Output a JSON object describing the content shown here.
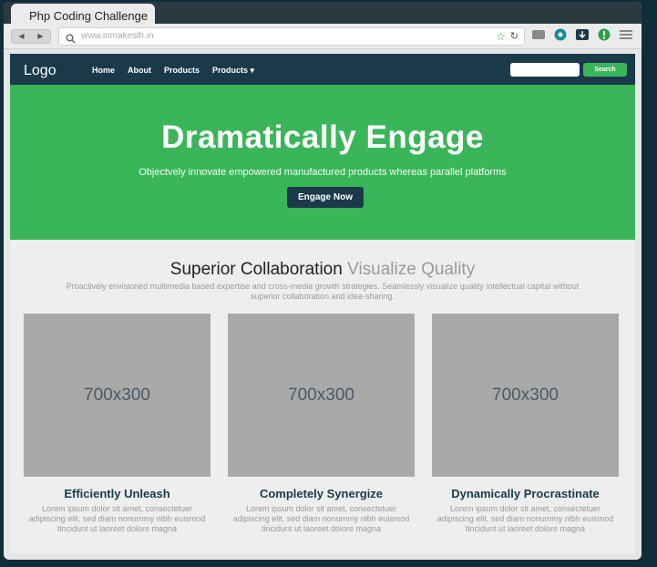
{
  "browser": {
    "tab_title": "Php Coding Challenge",
    "url": "www.inmakeslh.in",
    "nav": {
      "back": "◀",
      "forward": "▶"
    }
  },
  "navbar": {
    "logo": "Logo",
    "links": [
      "Home",
      "About",
      "Products",
      "Products ▾"
    ],
    "search_placeholder": "",
    "search_button": "Search"
  },
  "hero": {
    "title": "Dramatically Engage",
    "subtitle": "Objectvely innovate empowered manufactured products whereas parallel platforms",
    "cta": "Engage Now"
  },
  "section": {
    "title_main": "Superior Collaboration",
    "title_muted": "Visualize Quality",
    "subtitle": "Proactively envisioned multimedia based expertise and cross-media growth strategies. Seamlessly visualize quality intellectual capital without superior collaboration and idea-sharing."
  },
  "cards": [
    {
      "image": "700x300",
      "title": "Efficiently Unleash",
      "text": "Lorem ipsum dolor sit amet, consectetuer adipiscing elit, sed diam nonummy nibh euismod tincidunt ut laoreet dolore magna"
    },
    {
      "image": "700x300",
      "title": "Completely Synergize",
      "text": "Lorem ipsum dolor sit amet, consectetuer adipiscing elit, sed diam nonummy nibh euismod tincidunt ut laoreet dolore magna"
    },
    {
      "image": "700x300",
      "title": "Dynamically Procrastinate",
      "text": "Lorem ipsum dolor sit amet, consectetuer adipiscing elit, sed diam nonummy nibh euismod tincidunt ut laoreet dolore magna"
    }
  ],
  "colors": {
    "navy": "#1a3a4a",
    "green": "#3bb55a",
    "placeholder_gray": "#a9a9a9",
    "muted_text": "#9a9a9a"
  },
  "icons": [
    "search-icon",
    "star-icon",
    "reload-icon",
    "puzzle-icon",
    "shield-icon",
    "download-icon",
    "alert-icon",
    "menu-icon"
  ]
}
